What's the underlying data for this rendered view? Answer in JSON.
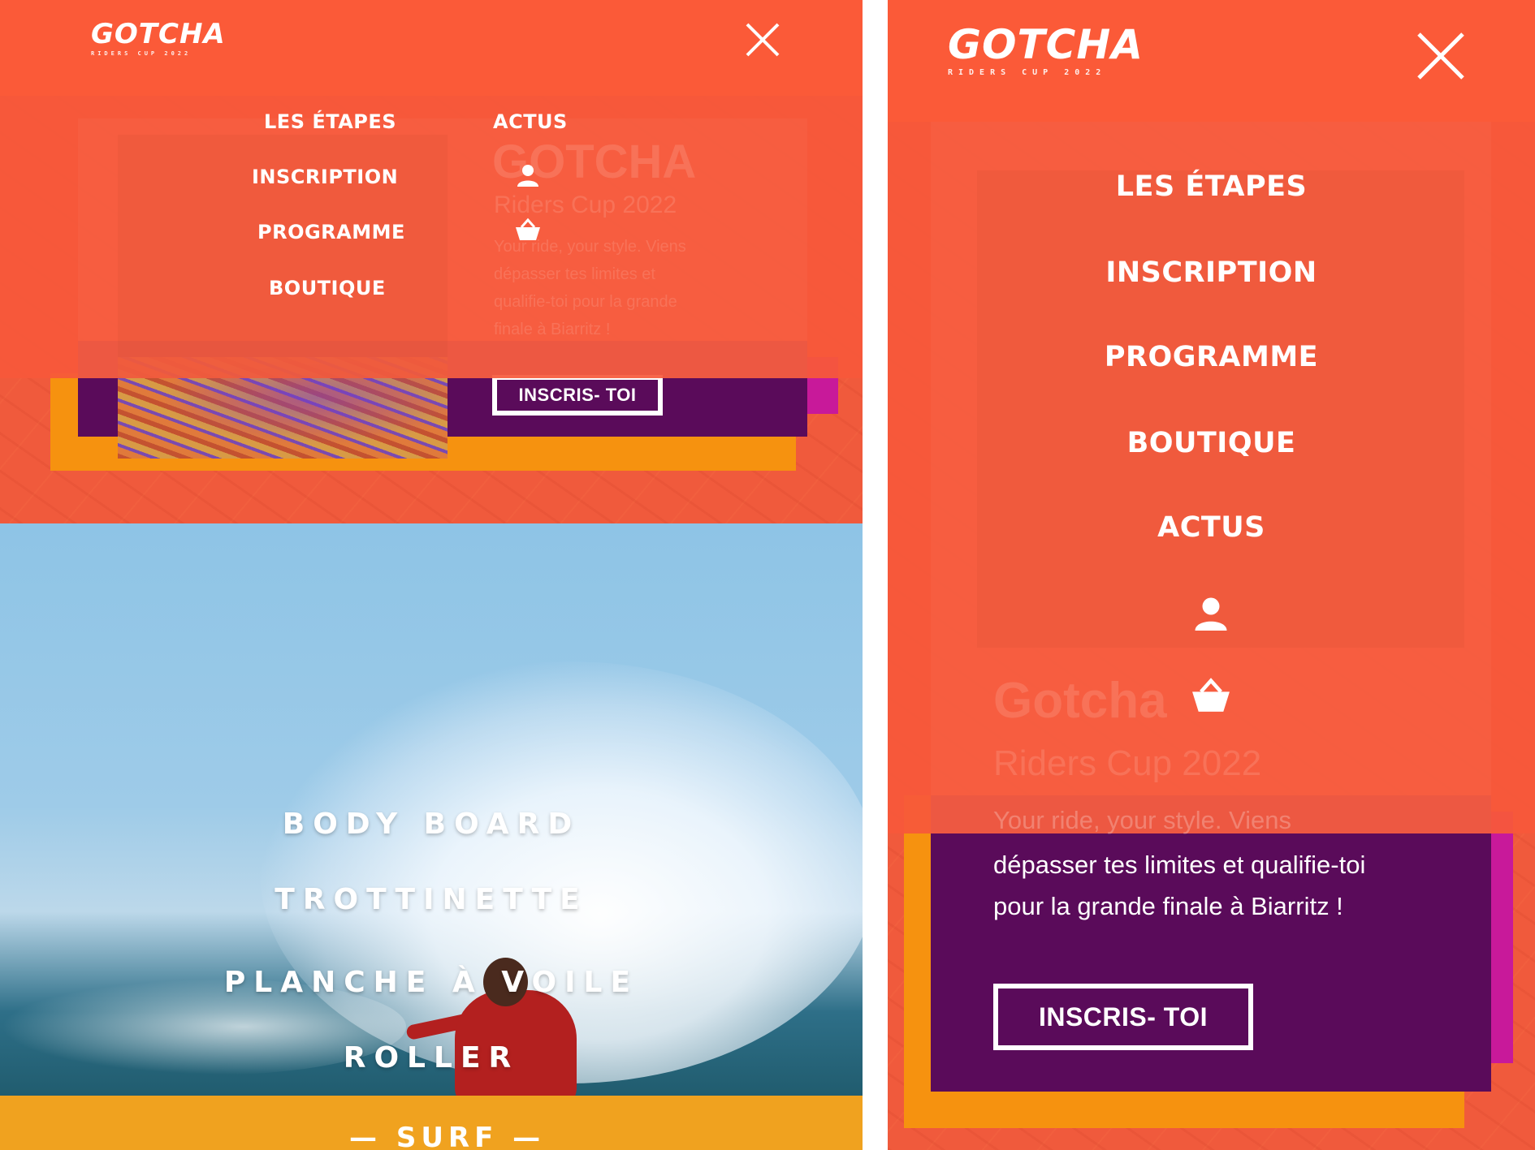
{
  "left": {
    "logo": {
      "main": "GOTCHA",
      "sub": "RIDERS CUP 2022"
    },
    "menu": {
      "col1": [
        "LES ÉTAPES",
        "INSCRIPTION",
        "PROGRAMME",
        "BOUTIQUE"
      ],
      "col2": [
        "ACTUS"
      ]
    },
    "hero_ghost": {
      "title": "GOTCHA",
      "subtitle": "Riders Cup 2022",
      "desc_lines": [
        "Your ride, your style. Viens",
        "dépasser tes limites et",
        "qualifie-toi pour la grande",
        "finale à Biarritz !"
      ]
    },
    "cta": "INSCRIS- TOI",
    "sports": [
      "BODY BOARD",
      "TROTTINETTE",
      "PLANCHE À VOILE",
      "ROLLER"
    ],
    "surf_label": "— SURF —"
  },
  "right": {
    "logo": {
      "main": "GOTCHA",
      "sub": "RIDERS CUP 2022"
    },
    "menu": [
      "LES ÉTAPES",
      "INSCRIPTION",
      "PROGRAMME",
      "BOUTIQUE",
      "ACTUS"
    ],
    "hero_ghost": {
      "title": "Gotcha",
      "subtitle": "Riders Cup 2022",
      "desc_first": "Your ride, your style. Viens"
    },
    "desc_lines": [
      "dépasser tes limites et qualifie-toi",
      "pour la grande finale à Biarritz !"
    ],
    "cta": "INSCRIS- TOI"
  },
  "colors": {
    "brand_orange": "#f2583a",
    "card_orange": "#f6920f",
    "purple": "#5a0b5a",
    "magenta": "#c8199a",
    "surf_bar": "#f0a21f"
  },
  "icons": [
    "close-icon",
    "user-icon",
    "basket-icon"
  ]
}
